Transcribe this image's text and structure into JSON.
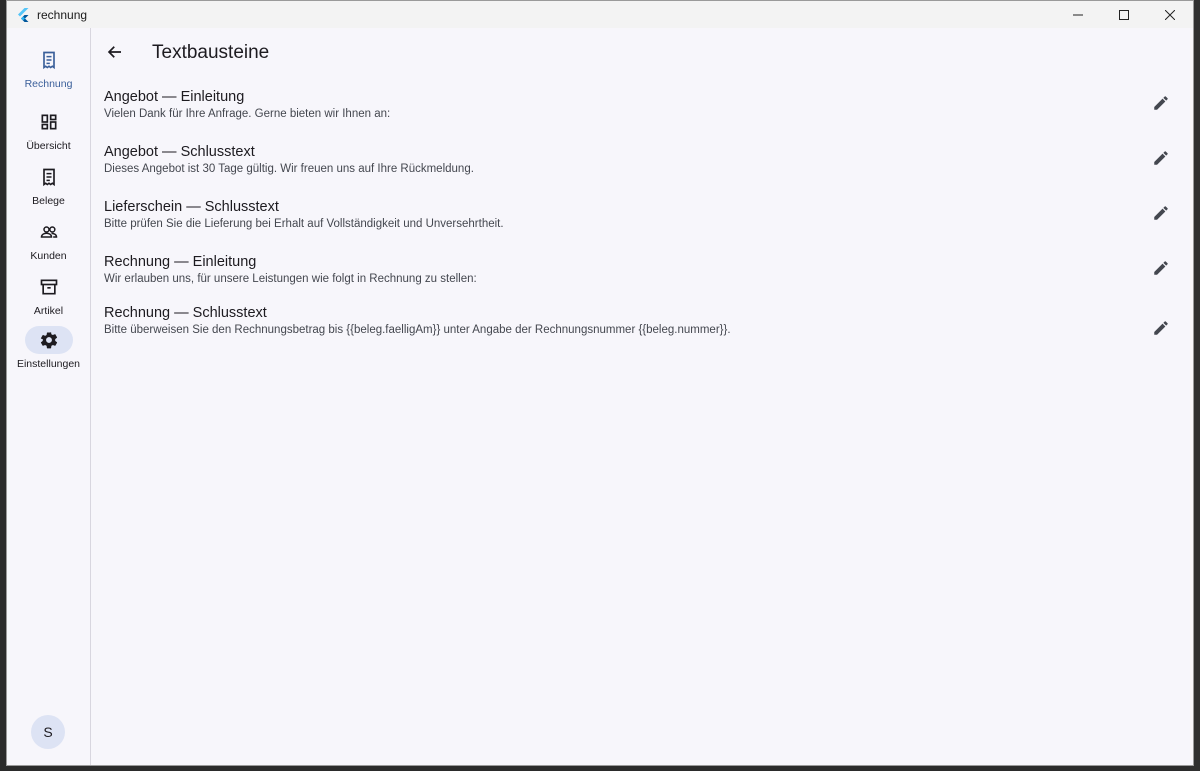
{
  "window": {
    "title": "rechnung"
  },
  "nav": {
    "items": [
      {
        "label": "Rechnung",
        "icon": "receipt-icon",
        "active": true
      },
      {
        "label": "Übersicht",
        "icon": "dashboard-icon"
      },
      {
        "label": "Belege",
        "icon": "receipt-long-icon"
      },
      {
        "label": "Kunden",
        "icon": "people-icon"
      },
      {
        "label": "Artikel",
        "icon": "inventory-icon"
      },
      {
        "label": "Einstellungen",
        "icon": "gear-icon",
        "selected": true
      }
    ],
    "avatar": "S"
  },
  "page": {
    "title": "Textbausteine",
    "items": [
      {
        "title": "Angebot — Einleitung",
        "text": "Vielen Dank für Ihre Anfrage. Gerne bieten wir Ihnen an:"
      },
      {
        "title": "Angebot — Schlusstext",
        "text": "Dieses Angebot ist 30 Tage gültig. Wir freuen uns auf Ihre Rückmeldung."
      },
      {
        "title": "Lieferschein — Schlusstext",
        "text": "Bitte prüfen Sie die Lieferung bei Erhalt auf Vollständigkeit und Unversehrtheit."
      },
      {
        "title": "Rechnung — Einleitung",
        "text": "Wir erlauben uns, für unsere Leistungen wie folgt in Rechnung zu stellen:"
      },
      {
        "title": "Rechnung — Schlusstext",
        "text": "Bitte überweisen Sie den Rechnungsbetrag bis {{beleg.faelligAm}} unter Angabe der Rechnungsnummer {{beleg.nummer}}."
      }
    ]
  },
  "colors": {
    "accent": "#3a5f9a",
    "selected_pill": "#dde3f4",
    "background": "#f7f6fb"
  }
}
